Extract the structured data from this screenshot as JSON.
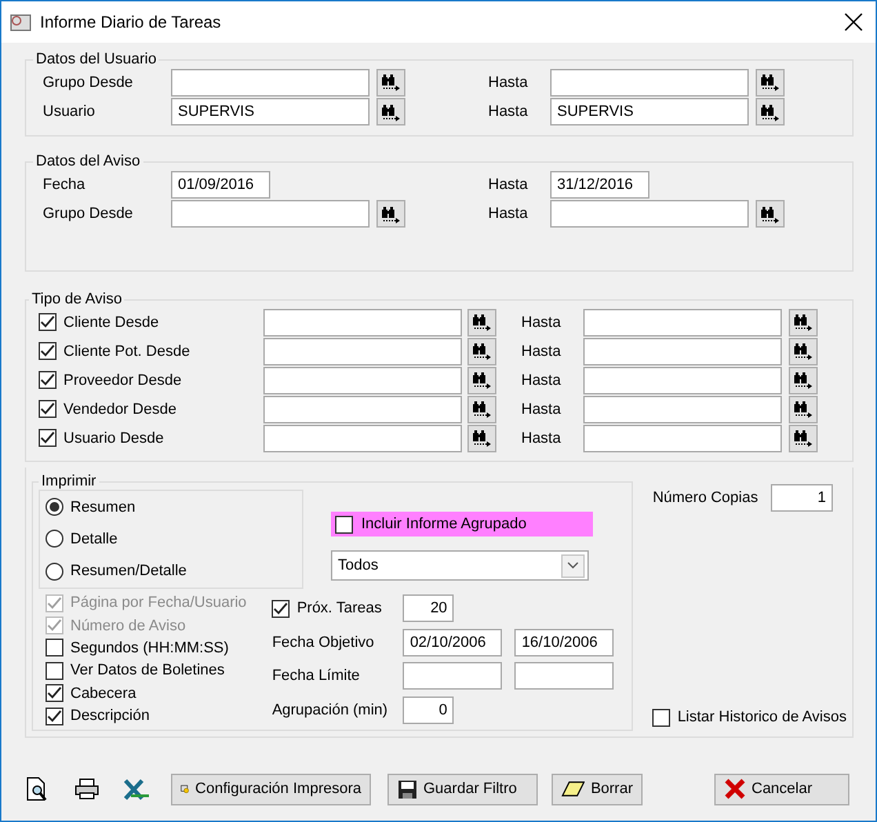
{
  "window": {
    "title": "Informe Diario de Tareas"
  },
  "datos_usuario": {
    "title": "Datos del Usuario",
    "rows": [
      {
        "kind": "lookup",
        "label": "Grupo Desde",
        "hasta_label": "Hasta"
      },
      {
        "kind": "lookup",
        "label": "Usuario",
        "from": "SUPERVIS",
        "hasta_label": "Hasta",
        "to": "SUPERVIS"
      }
    ]
  },
  "datos_aviso": {
    "title": "Datos del Aviso",
    "rows": [
      {
        "kind": "date",
        "label": "Fecha",
        "from": "01/09/2016",
        "hasta_label": "Hasta",
        "to": "31/12/2016"
      },
      {
        "kind": "lookup",
        "label": "Grupo Desde",
        "hasta_label": "Hasta"
      }
    ]
  },
  "tipo_aviso": {
    "title": "Tipo de Aviso",
    "rows": [
      {
        "label": "Cliente Desde",
        "checked": true,
        "hasta_label": "Hasta"
      },
      {
        "label": "Cliente Pot. Desde",
        "checked": true,
        "hasta_label": "Hasta"
      },
      {
        "label": "Proveedor Desde",
        "checked": true,
        "hasta_label": "Hasta"
      },
      {
        "label": "Vendedor Desde",
        "checked": true,
        "hasta_label": "Hasta"
      },
      {
        "label": "Usuario Desde",
        "checked": true,
        "hasta_label": "Hasta"
      }
    ]
  },
  "imprimir": {
    "title": "Imprimir",
    "report_types": [
      {
        "label": "Resumen",
        "selected": true
      },
      {
        "label": "Detalle",
        "selected": false
      },
      {
        "label": "Resumen/Detalle",
        "selected": false
      }
    ],
    "incluir": {
      "label": "Incluir Informe Agrupado",
      "checked": false
    },
    "select": {
      "value": "Todos"
    },
    "options": [
      {
        "label": "Página por Fecha/Usuario",
        "checked": true,
        "disabled": true
      },
      {
        "label": "Número de Aviso",
        "checked": true,
        "disabled": true
      },
      {
        "label": "Segundos (HH:MM:SS)",
        "checked": false,
        "disabled": false
      },
      {
        "label": "Ver Datos de Boletines",
        "checked": false,
        "disabled": false
      },
      {
        "label": "Cabecera",
        "checked": true,
        "disabled": false
      },
      {
        "label": "Descripción",
        "checked": true,
        "disabled": false
      }
    ],
    "prox_tareas": {
      "label": "Próx. Tareas",
      "checked": true,
      "value": "20"
    },
    "fecha_objetivo": {
      "label": "Fecha Objetivo",
      "from": "02/10/2006",
      "to": "16/10/2006"
    },
    "fecha_limite": {
      "label": "Fecha Límite"
    },
    "agrupacion": {
      "label": "Agrupación (min)",
      "value": "0"
    }
  },
  "copias": {
    "label": "Número Copias",
    "value": "1"
  },
  "listar": {
    "label": "Listar Historico de Avisos",
    "checked": false
  },
  "toolbar": {
    "icons": [
      {
        "kind": "preview"
      },
      {
        "kind": "print"
      },
      {
        "kind": "excel"
      }
    ],
    "buttons": [
      {
        "kind": "config",
        "label": "Configuración Impresora"
      },
      {
        "kind": "save",
        "label": "Guardar Filtro"
      },
      {
        "kind": "erase",
        "label": "Borrar"
      },
      {
        "kind": "cancel",
        "label": "Cancelar"
      }
    ]
  }
}
